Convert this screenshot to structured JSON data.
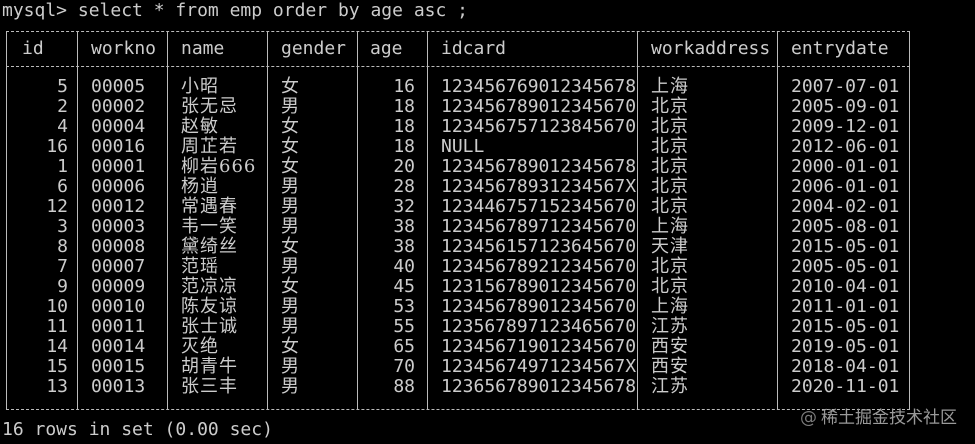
{
  "terminal": {
    "prompt": "mysql>",
    "command": " select * from emp order by age asc ;",
    "footer": "16 rows in set (0.00 sec)"
  },
  "table": {
    "columns": [
      "id",
      "workno",
      "name",
      "gender",
      "age",
      "idcard",
      "workaddress",
      "entrydate"
    ],
    "rows": [
      [
        "5",
        "00005",
        "小昭",
        "女",
        "16",
        "123456769012345678",
        "上海",
        "2007-07-01"
      ],
      [
        "2",
        "00002",
        "张无忌",
        "男",
        "18",
        "123456789012345670",
        "北京",
        "2005-09-01"
      ],
      [
        "4",
        "00004",
        "赵敏",
        "女",
        "18",
        "123456757123845670",
        "北京",
        "2009-12-01"
      ],
      [
        "16",
        "00016",
        "周芷若",
        "女",
        "18",
        "NULL",
        "北京",
        "2012-06-01"
      ],
      [
        "1",
        "00001",
        "柳岩666",
        "女",
        "20",
        "123456789012345678",
        "北京",
        "2000-01-01"
      ],
      [
        "6",
        "00006",
        "杨逍",
        "男",
        "28",
        "12345678931234567X",
        "北京",
        "2006-01-01"
      ],
      [
        "12",
        "00012",
        "常遇春",
        "男",
        "32",
        "123446757152345670",
        "北京",
        "2004-02-01"
      ],
      [
        "3",
        "00003",
        "韦一笑",
        "男",
        "38",
        "123456789712345670",
        "上海",
        "2005-08-01"
      ],
      [
        "8",
        "00008",
        "黛绮丝",
        "女",
        "38",
        "123456157123645670",
        "天津",
        "2015-05-01"
      ],
      [
        "7",
        "00007",
        "范瑶",
        "男",
        "40",
        "123456789212345670",
        "北京",
        "2005-05-01"
      ],
      [
        "9",
        "00009",
        "范凉凉",
        "女",
        "45",
        "123156789012345670",
        "北京",
        "2010-04-01"
      ],
      [
        "10",
        "00010",
        "陈友谅",
        "男",
        "53",
        "123456789012345670",
        "上海",
        "2011-01-01"
      ],
      [
        "11",
        "00011",
        "张士诚",
        "男",
        "55",
        "123567897123465670",
        "江苏",
        "2015-05-01"
      ],
      [
        "14",
        "00014",
        "灭绝",
        "女",
        "65",
        "123456719012345670",
        "西安",
        "2019-05-01"
      ],
      [
        "15",
        "00015",
        "胡青牛",
        "男",
        "70",
        "12345674971234567X",
        "西安",
        "2018-04-01"
      ],
      [
        "13",
        "00013",
        "张三丰",
        "男",
        "88",
        "123656789012345678",
        "江苏",
        "2020-11-01"
      ]
    ]
  },
  "watermark": {
    "logo": "@",
    "text": "稀土掘金技术社区"
  },
  "colors": {
    "background": "#000000",
    "text": "#cccccc",
    "border": "#bbbbbb",
    "watermark": "#9a9a9a"
  }
}
